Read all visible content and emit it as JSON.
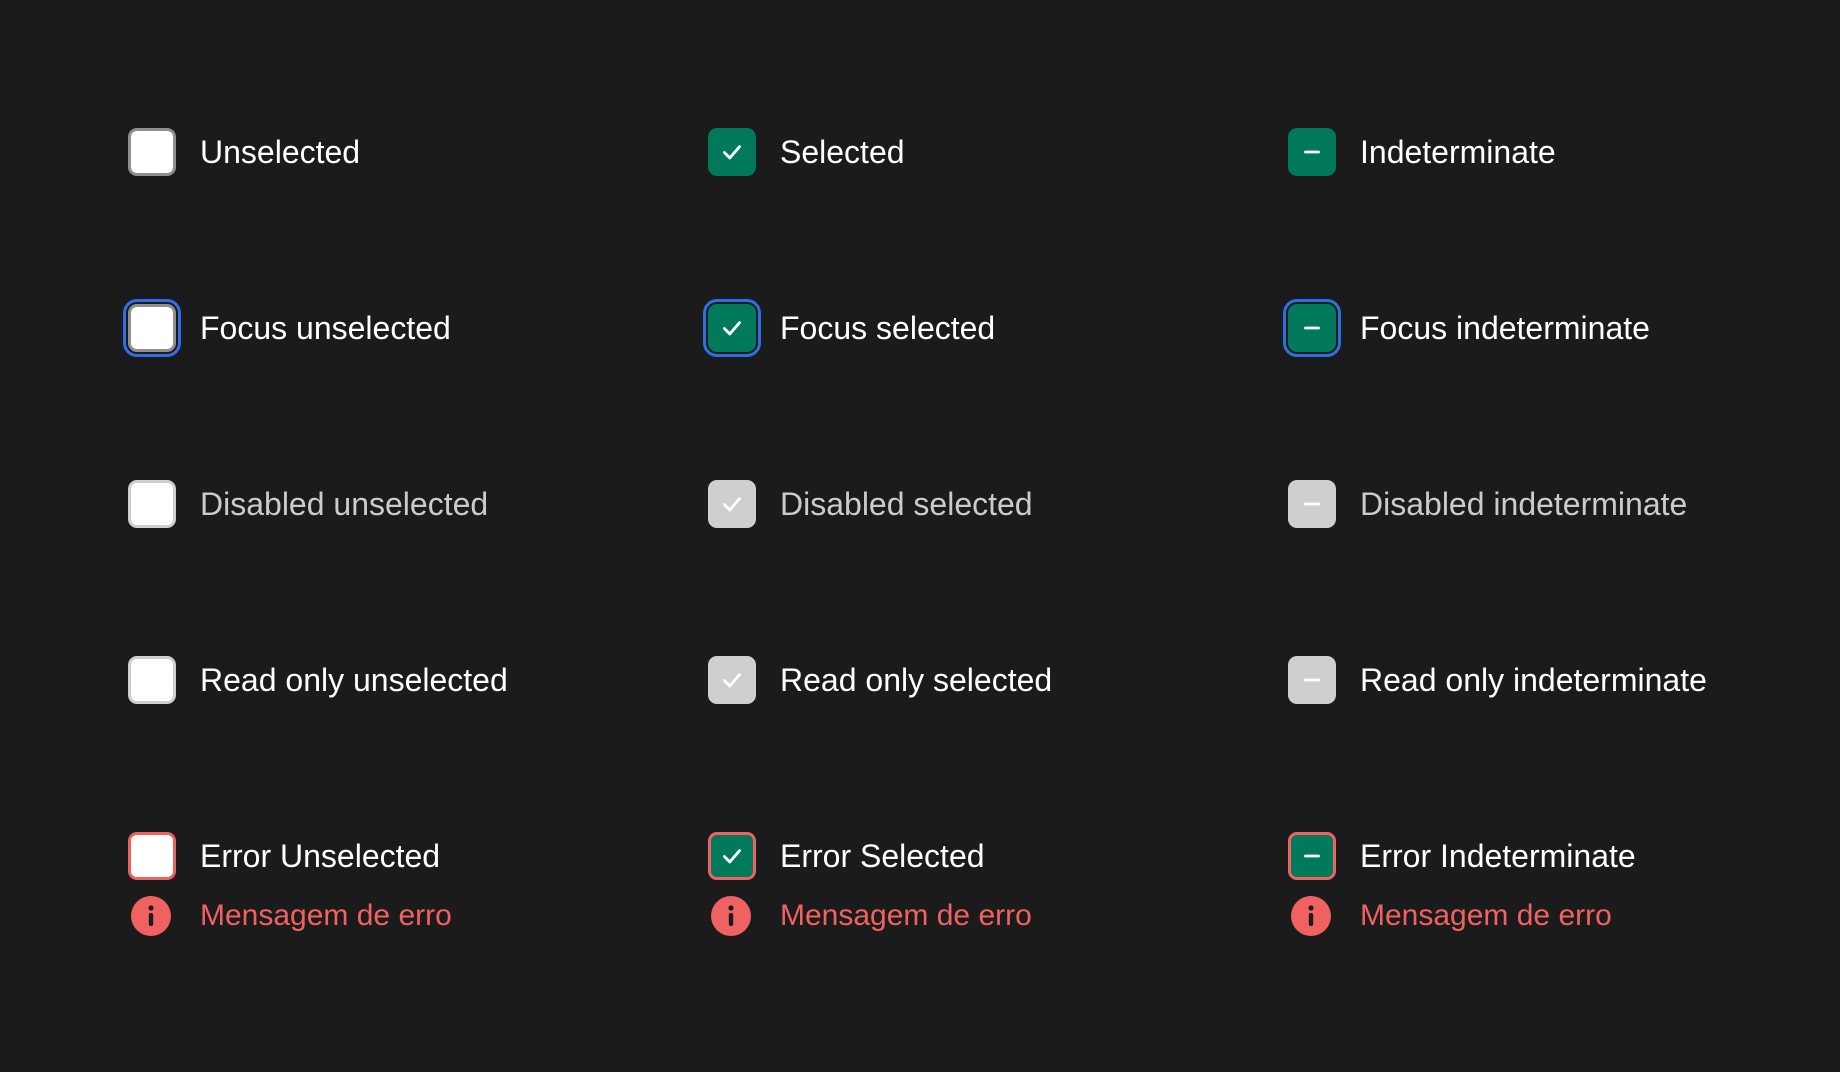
{
  "colors": {
    "background": "#1b1b1b",
    "checked": "#007a5a",
    "focus_ring": "#2f6fe4",
    "error": "#f06262",
    "disabled": "#cfcfcf",
    "unselected_border": "#8f8f8f",
    "label": "#ffffff",
    "label_muted": "#cbcbcb"
  },
  "labels": {
    "unselected": "Unselected",
    "selected": "Selected",
    "indeterminate": "Indeterminate",
    "focus_unselected": "Focus unselected",
    "focus_selected": "Focus selected",
    "focus_indeterminate": "Focus indeterminate",
    "disabled_unselected": "Disabled unselected",
    "disabled_selected": "Disabled selected",
    "disabled_indeterminate": "Disabled indeterminate",
    "readonly_unselected": "Read only unselected",
    "readonly_selected": "Read only selected",
    "readonly_indeterminate": "Read only indeterminate",
    "error_unselected": "Error Unselected",
    "error_selected": "Error Selected",
    "error_indeterminate": "Error Indeterminate"
  },
  "error_message": "Mensagem de erro",
  "icons": {
    "check": "check-icon",
    "minus": "minus-icon",
    "error": "error-info-icon"
  }
}
